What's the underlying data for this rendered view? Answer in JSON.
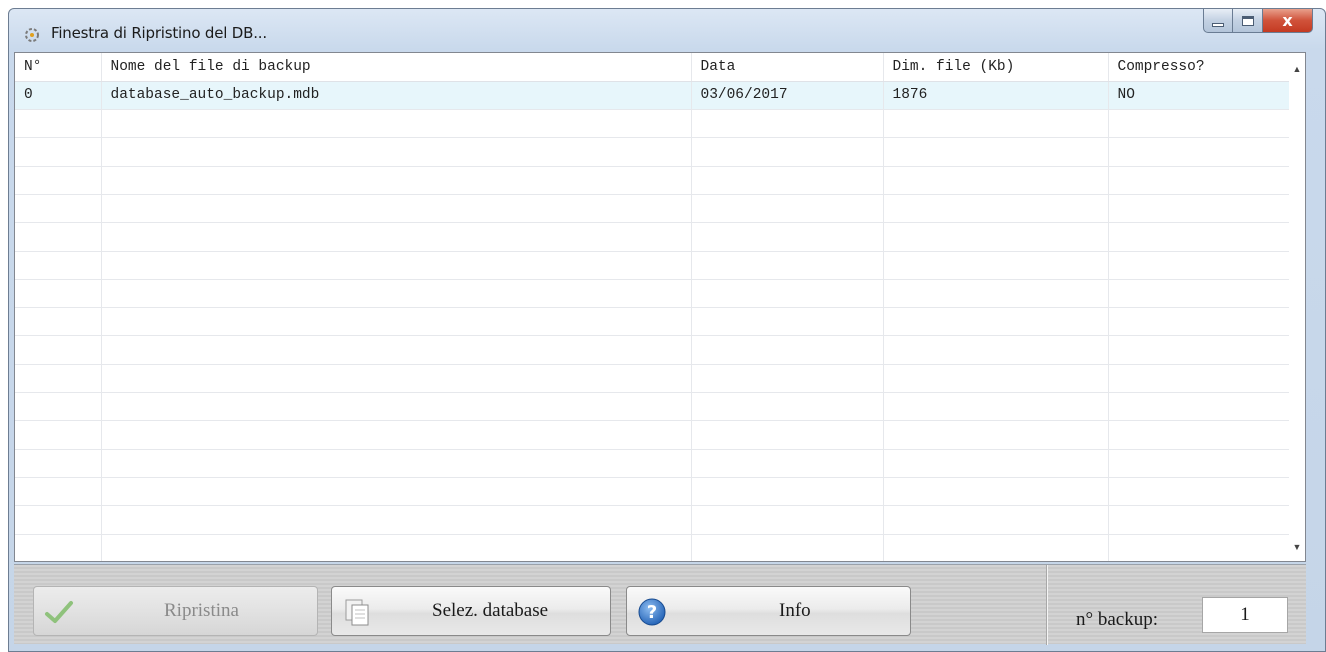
{
  "window": {
    "title": "Finestra di Ripristino del DB...",
    "close_glyph": "x"
  },
  "table": {
    "headers": [
      "N°",
      "Nome del file di backup",
      "Data",
      "Dim. file (Kb)",
      "Compresso?"
    ],
    "rows": [
      [
        "0",
        "database_auto_backup.mdb",
        "03/06/2017",
        "1876",
        "NO"
      ]
    ],
    "selected_row": 0
  },
  "buttons": {
    "ripristina": "Ripristina",
    "selez": "Selez. database",
    "info": "Info"
  },
  "backup_count": {
    "label": "n° backup:",
    "value": "1"
  },
  "colors": {
    "selected_row": "#e7f6fb",
    "close_button": "#c43a22",
    "info_icon": "#2d6fc4",
    "check_icon": "#5aa845"
  },
  "icons": {
    "app": "app-icon",
    "ripristina": "check-icon",
    "selez": "documents-icon",
    "info": "question-icon"
  }
}
